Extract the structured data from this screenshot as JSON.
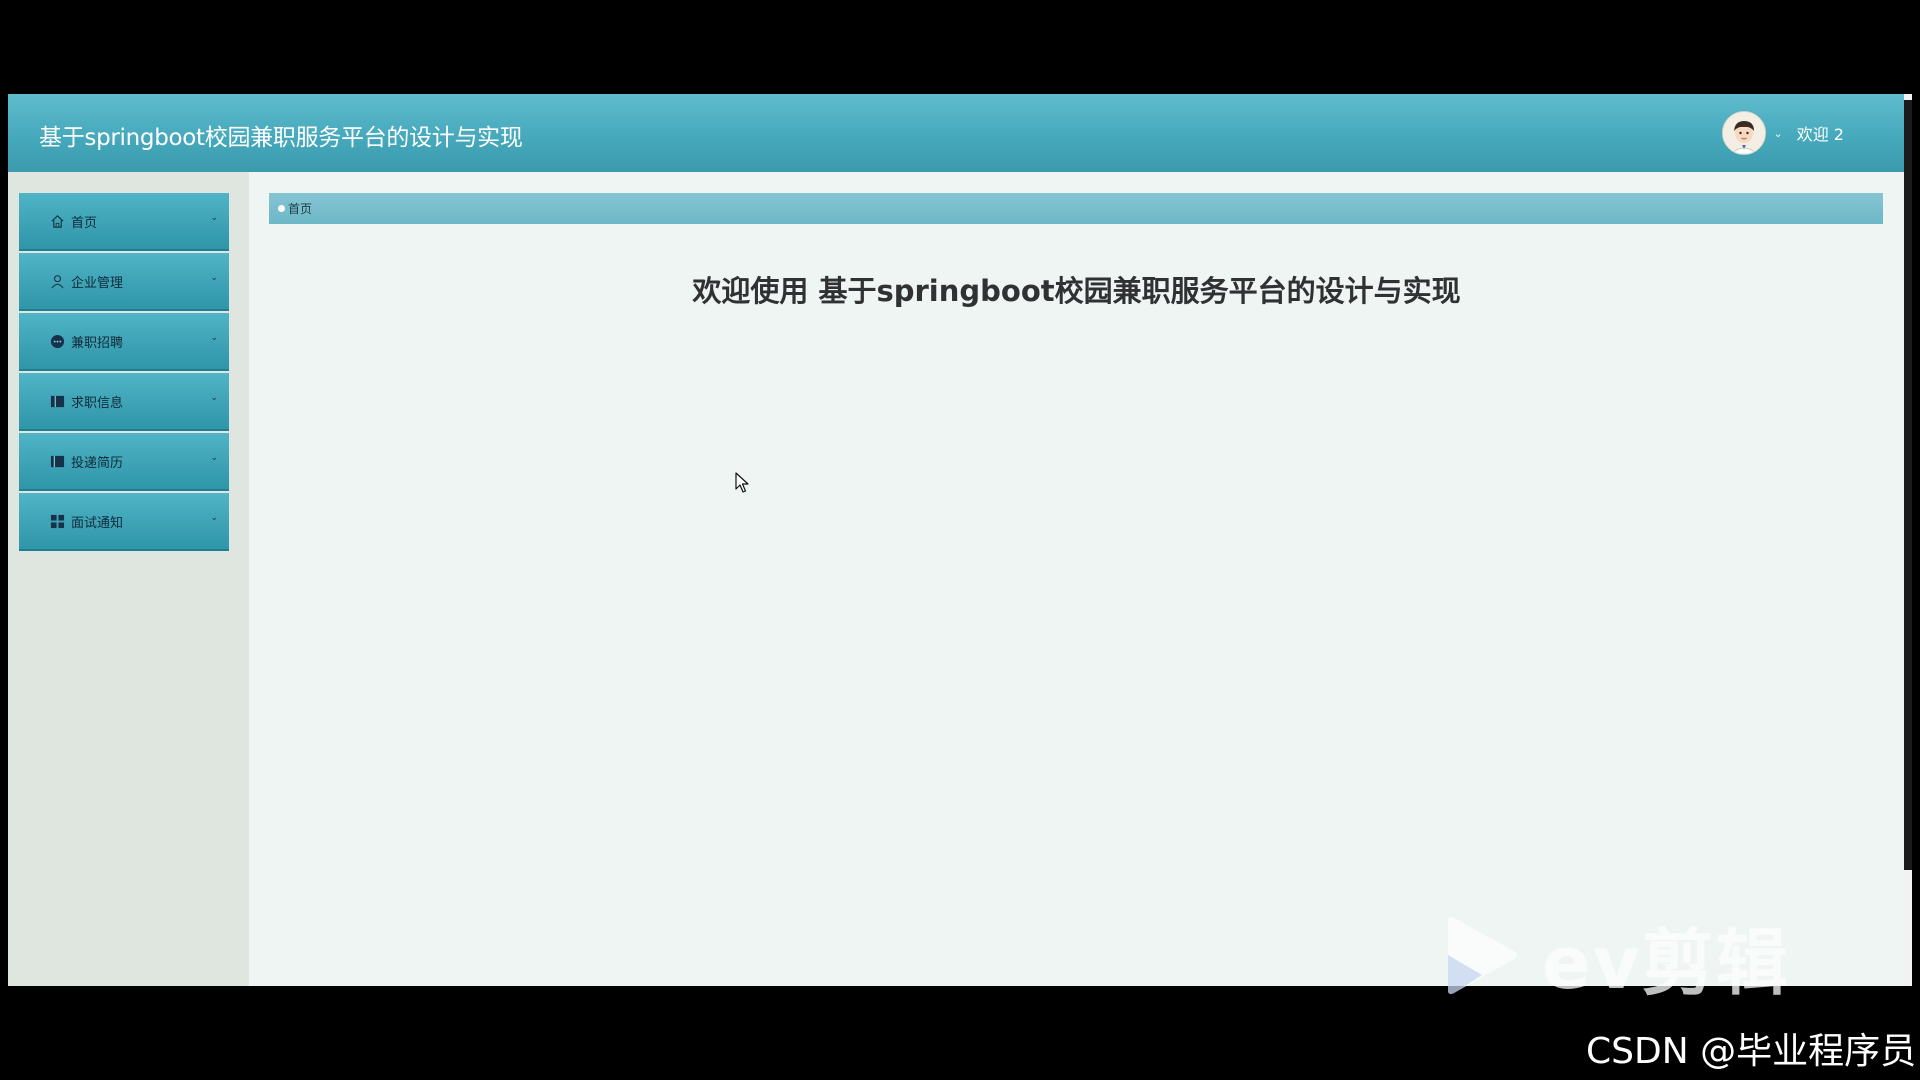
{
  "header": {
    "title": "基于springboot校园兼职服务平台的设计与实现",
    "welcome": "欢迎 2",
    "avatar_icon": "avatar-icon",
    "caret_icon": "chevron-down-icon"
  },
  "sidebar": {
    "items": [
      {
        "label": "首页",
        "icon": "home-icon"
      },
      {
        "label": "企业管理",
        "icon": "user-icon"
      },
      {
        "label": "兼职招聘",
        "icon": "chat-bubble-icon"
      },
      {
        "label": "求职信息",
        "icon": "book-icon"
      },
      {
        "label": "投递简历",
        "icon": "notebook-icon"
      },
      {
        "label": "面试通知",
        "icon": "grid-icon"
      }
    ]
  },
  "breadcrumb": {
    "items": [
      "首页"
    ]
  },
  "main": {
    "welcome_title": "欢迎使用 基于springboot校园兼职服务平台的设计与实现"
  },
  "overlay": {
    "video_watermark": "ev剪辑",
    "csdn_watermark": "CSDN @毕业程序员"
  },
  "colors": {
    "header": "#4aacbf",
    "menu_item": "#3fa6b8",
    "breadcrumb": "#7bbecd",
    "content_bg": "#eef5f3",
    "sidebar_bg": "#dfe6e0"
  }
}
